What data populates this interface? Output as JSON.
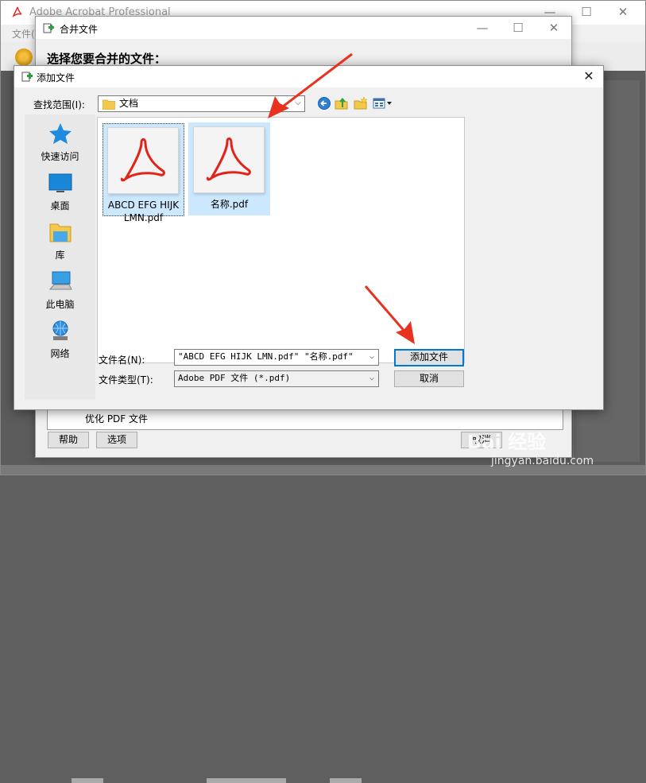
{
  "main_window": {
    "title": "Adobe Acrobat Professional",
    "menu_first": "文件(",
    "min_glyph": "—",
    "max_glyph": "☐",
    "close_glyph": "✕"
  },
  "merge_dialog": {
    "title": "合并文件",
    "heading": "选择您要合并的文件：",
    "optimize_row": "优化 PDF 文件",
    "help_button": "帮助",
    "options_button": "选项",
    "cancel_button": "取消",
    "min_glyph": "—",
    "max_glyph": "☐",
    "close_glyph": "✕"
  },
  "add_dialog": {
    "title": "添加文件",
    "close_glyph": "✕",
    "lookin_label": "查找范围(I):",
    "lookin_value": "文档",
    "places": [
      {
        "label": "快速访问",
        "icon": "star-icon"
      },
      {
        "label": "桌面",
        "icon": "desktop-icon"
      },
      {
        "label": "库",
        "icon": "library-icon"
      },
      {
        "label": "此电脑",
        "icon": "computer-icon"
      },
      {
        "label": "网络",
        "icon": "network-icon"
      }
    ],
    "files": [
      {
        "name_line1": "ABCD  EFG  HIJK",
        "name_line2": "LMN.pdf",
        "icon": "pdf-icon"
      },
      {
        "name_line1": "名称.pdf",
        "name_line2": "",
        "icon": "pdf-icon"
      }
    ],
    "filename_label": "文件名(N):",
    "filename_value": "\"ABCD  EFG  HIJK  LMN.pdf\" \"名称.pdf\"",
    "filetype_label": "文件类型(T):",
    "filetype_value": "Adobe PDF 文件 (*.pdf)",
    "add_button": "添加文件",
    "cancel_button": "取消",
    "dropdown_glyph": "⌵"
  },
  "watermark": {
    "brand": "Bai 经验",
    "url": "jingyan.baidu.com"
  },
  "colors": {
    "pdf_red": "#e2231a",
    "selection": "#cce8ff",
    "annotation_arrow": "#e8321f"
  }
}
